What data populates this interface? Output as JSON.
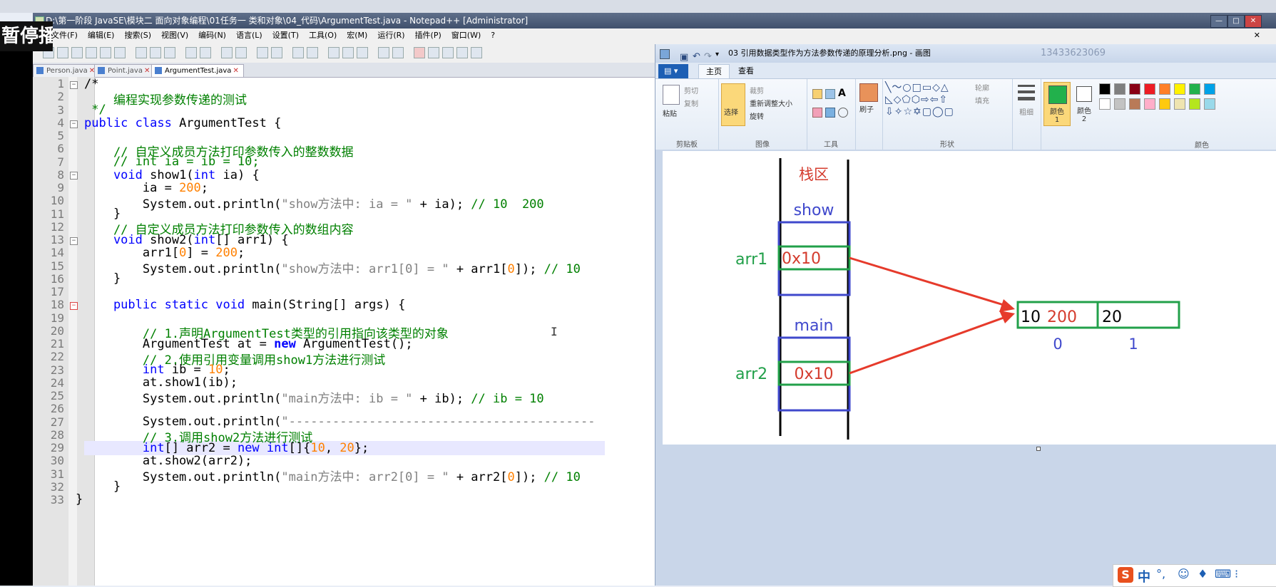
{
  "overlay": {
    "pause_label": "暂停播放"
  },
  "npp": {
    "title": "D:\\第一阶段 JavaSE\\模块二 面向对象编程\\01任务一 类和对象\\04_代码\\ArgumentTest.java - Notepad++ [Administrator]",
    "menu": [
      "文件(F)",
      "编辑(E)",
      "搜索(S)",
      "视图(V)",
      "编码(N)",
      "语言(L)",
      "设置(T)",
      "工具(O)",
      "宏(M)",
      "运行(R)",
      "插件(P)",
      "窗口(W)",
      "?"
    ],
    "tabs": [
      "Person.java",
      "Point.java",
      "ArgumentTest.java"
    ],
    "line_numbers": [
      "1",
      "2",
      "3",
      "4",
      "5",
      "6",
      "7",
      "8",
      "9",
      "10",
      "11",
      "12",
      "13",
      "14",
      "15",
      "16",
      "17",
      "18",
      "19",
      "20",
      "21",
      "22",
      "23",
      "24",
      "25",
      "26",
      "27",
      "28",
      "29",
      "30",
      "31",
      "32",
      "33"
    ],
    "code": {
      "l1": "/*",
      "l2": "    编程实现参数传递的测试",
      "l3": " */",
      "l4a": "public class",
      "l4b": " ArgumentTest {",
      "l6": "    // 自定义成员方法打印参数传入的整数数据",
      "l7": "    // int ia = ib = 10;",
      "l8a": "    void",
      "l8b": " show1(",
      "l8c": "int",
      "l8d": " ia) {",
      "l9a": "        ia = ",
      "l9b": "200",
      "l9c": ";",
      "l10a": "        System.out.println(",
      "l10b": "\"show方法中: ia = \"",
      "l10c": " + ia); ",
      "l10d": "// 10  200",
      "l11": "    }",
      "l12": "    // 自定义成员方法打印参数传入的数组内容",
      "l13a": "    void",
      "l13b": " show2(",
      "l13c": "int",
      "l13d": "[] arr1) {",
      "l14a": "        arr1[",
      "l14b": "0",
      "l14c": "] = ",
      "l14d": "200",
      "l14e": ";",
      "l15a": "        System.out.println(",
      "l15b": "\"show方法中: arr1[0] = \"",
      "l15c": " + arr1[",
      "l15d": "0",
      "l15e": "]); ",
      "l15f": "// 10",
      "l16": "    }",
      "l18a": "    public static void",
      "l18b": " main(String[] args) {",
      "l20": "        // 1.声明ArgumentTest类型的引用指向该类型的对象",
      "l21a": "        ArgumentTest at = ",
      "l21b": "new",
      "l21c": " ArgumentTest();",
      "l22": "        // 2.使用引用变量调用show1方法进行测试",
      "l23a": "        int",
      "l23b": " ib = ",
      "l23c": "10",
      "l23d": ";",
      "l24": "        at.show1(ib);",
      "l25a": "        System.out.println(",
      "l25b": "\"main方法中: ib = \"",
      "l25c": " + ib); ",
      "l25d": "// ib = 10",
      "l27a": "        System.out.println(",
      "l27b": "\"------------------------------------------",
      "l28": "        // 3.调用show2方法进行测试",
      "l29a": "        int",
      "l29b": "[] arr2 = ",
      "l29c": "new int",
      "l29d": "[]{",
      "l29e": "10",
      "l29f": ", ",
      "l29g": "20",
      "l29h": "};",
      "l30": "        at.show2(arr2);",
      "l31a": "        System.out.println(",
      "l31b": "\"main方法中: arr2[0] = \"",
      "l31c": " + arr2[",
      "l31d": "0",
      "l31e": "]); ",
      "l31f": "// 10",
      "l32": "    }",
      "l33": "}"
    }
  },
  "paint": {
    "title": "03 引用数据类型作为方法参数传递的原理分析.png - 画图",
    "phone": "13433623069",
    "tabs": [
      "主页",
      "查看"
    ],
    "ribbon": {
      "clipboard": {
        "paste": "粘贴",
        "cut": "剪切",
        "copy": "复制",
        "group": "剪贴板"
      },
      "image": {
        "select": "选择",
        "crop": "裁剪",
        "resize": "重新调整大小",
        "rotate": "旋转",
        "group": "图像"
      },
      "tools": {
        "group": "工具"
      },
      "brush": {
        "label": "刷子"
      },
      "shapes": {
        "outline": "轮廓",
        "fill": "填充",
        "group": "形状"
      },
      "size": {
        "label": "粗细"
      },
      "color1": "颜色 1",
      "color2": "颜色 2",
      "colors_group": "颜色"
    },
    "palette": [
      "#000000",
      "#7f7f7f",
      "#880015",
      "#ed1c24",
      "#ff7f27",
      "#fff200",
      "#22b14c",
      "#00a2e8",
      "#ffffff",
      "#c3c3c3",
      "#b97a57",
      "#ffaec9",
      "#ffc90e",
      "#efe4b0",
      "#b5e61d",
      "#99d9ea"
    ],
    "diagram": {
      "stack_label": "栈区",
      "show_label": "show",
      "main_label": "main",
      "arr1_label": "arr1",
      "arr2_label": "arr2",
      "arr1_value": "0x10",
      "arr2_value": "0x10",
      "heap_cell0_old": "10",
      "heap_cell0_new": "200",
      "heap_cell1": "20",
      "index0": "0",
      "index1": "1"
    }
  },
  "ime": {
    "label": "中"
  }
}
